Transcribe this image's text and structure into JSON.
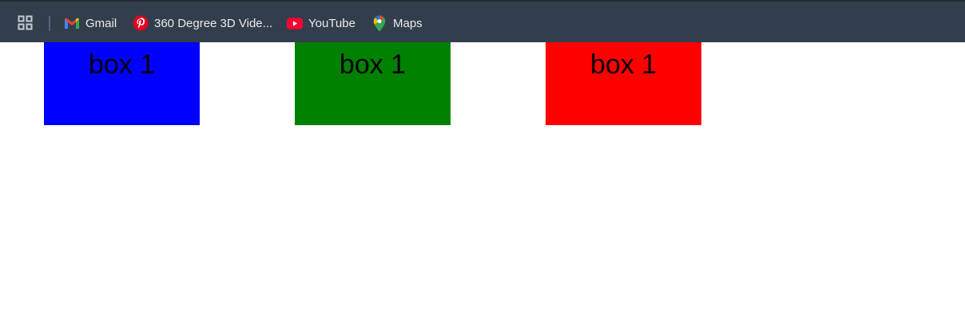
{
  "bookmarks_bar": {
    "apps_icon": "apps-grid-icon",
    "items": [
      {
        "label": "Gmail",
        "icon": "gmail-icon"
      },
      {
        "label": "360 Degree 3D Vide...",
        "icon": "pinterest-icon"
      },
      {
        "label": "YouTube",
        "icon": "youtube-icon"
      },
      {
        "label": "Maps",
        "icon": "maps-pin-icon"
      }
    ],
    "colors": {
      "background": "#333e4c",
      "text": "#e8eaed"
    }
  },
  "boxes": [
    {
      "label": "box 1",
      "color": "#0000ff"
    },
    {
      "label": "box 1",
      "color": "#008000"
    },
    {
      "label": "box 1",
      "color": "#ff0000"
    }
  ]
}
